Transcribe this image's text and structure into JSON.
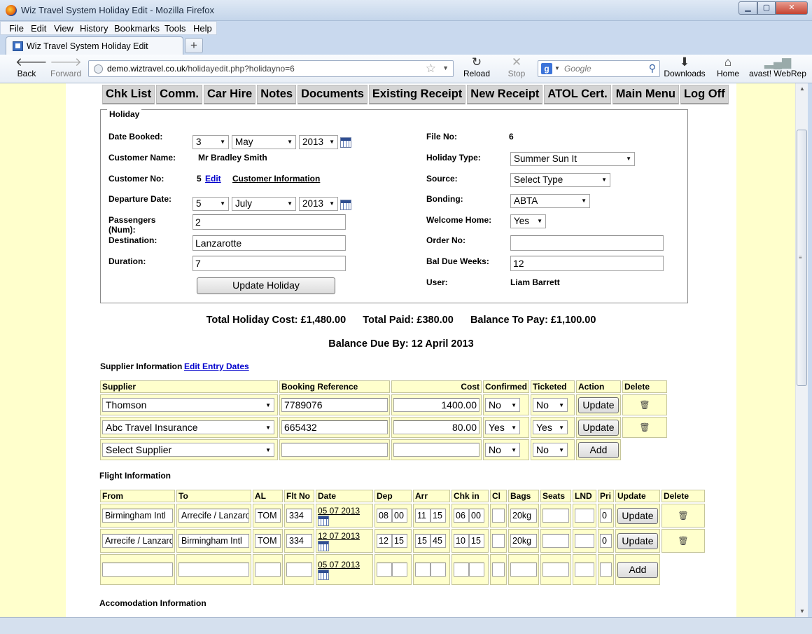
{
  "window": {
    "title": "Wiz Travel System Holiday Edit - Mozilla Firefox"
  },
  "menu": [
    "File",
    "Edit",
    "View",
    "History",
    "Bookmarks",
    "Tools",
    "Help"
  ],
  "tab": {
    "label": "Wiz Travel System Holiday Edit"
  },
  "nav": {
    "back": "Back",
    "forward": "Forward",
    "reload": "Reload",
    "stop": "Stop",
    "downloads": "Downloads",
    "home": "Home",
    "avast": "avast! WebRep",
    "url_host": "demo.wiztravel.co.uk",
    "url_path": "/holidayedit.php?holidayno=6",
    "search_placeholder": "Google"
  },
  "topnav": [
    "Chk List",
    "Comm.",
    "Car Hire",
    "Notes",
    "Documents",
    "Existing Receipt",
    "New Receipt",
    "ATOL Cert.",
    "Main Menu",
    "Log Off"
  ],
  "holiday": {
    "legend": "Holiday",
    "date_booked_label": "Date Booked:",
    "date_booked": {
      "day": "3",
      "month": "May",
      "year": "2013"
    },
    "customer_name_label": "Customer Name:",
    "customer_name": "Mr Bradley Smith",
    "customer_no_label": "Customer No:",
    "customer_no": "5",
    "edit_link": "Edit",
    "customer_info_link": "Customer Information",
    "departure_label": "Departure Date:",
    "departure": {
      "day": "5",
      "month": "July",
      "year": "2013"
    },
    "passengers_label_1": "Passengers",
    "passengers_label_2": "(Num):",
    "passengers": "2",
    "destination_label": "Destination:",
    "destination": "Lanzarotte",
    "duration_label": "Duration:",
    "duration": "7",
    "update_button": "Update Holiday",
    "file_no_label": "File No:",
    "file_no": "6",
    "holiday_type_label": "Holiday Type:",
    "holiday_type": "Summer Sun It",
    "source_label": "Source:",
    "source": "Select Type",
    "bonding_label": "Bonding:",
    "bonding": "ABTA",
    "welcome_home_label": "Welcome Home:",
    "welcome_home": "Yes",
    "order_no_label": "Order No:",
    "order_no": "",
    "bal_due_weeks_label": "Bal Due Weeks:",
    "bal_due_weeks": "12",
    "user_label": "User:",
    "user": "Liam Barrett"
  },
  "totals": {
    "line1": "Total Holiday Cost: £1,480.00      Total Paid: £380.00      Balance To Pay: £1,100.00",
    "line2": "Balance Due By: 12 April 2013"
  },
  "supplier": {
    "title": "Supplier Information",
    "edit_dates_link": "Edit Entry Dates",
    "headers": [
      "Supplier",
      "Booking Reference",
      "Cost",
      "Confirmed",
      "Ticketed",
      "Action",
      "Delete"
    ],
    "rows": [
      {
        "supplier": "Thomson",
        "ref": "7789076",
        "cost": "1400.00",
        "confirmed": "No",
        "ticketed": "No",
        "action": "Update"
      },
      {
        "supplier": "Abc Travel Insurance",
        "ref": "665432",
        "cost": "80.00",
        "confirmed": "Yes",
        "ticketed": "Yes",
        "action": "Update"
      }
    ],
    "new_row": {
      "supplier": "Select Supplier",
      "confirmed": "No",
      "ticketed": "No",
      "action": "Add"
    }
  },
  "flight": {
    "title": "Flight Information",
    "headers": [
      "From",
      "To",
      "AL",
      "Flt No",
      "Date",
      "Dep",
      "Arr",
      "Chk in",
      "Cl",
      "Bags",
      "Seats",
      "LND",
      "Pri",
      "Update",
      "Delete"
    ],
    "rows": [
      {
        "from": "Birmingham Intl",
        "to": "Arrecife / Lanzarote",
        "al": "TOM",
        "flt": "334",
        "date": "05 07 2013",
        "dep_h": "08",
        "dep_m": "00",
        "arr_h": "11",
        "arr_m": "15",
        "chk_h": "06",
        "chk_m": "00",
        "bags": "20kg",
        "pri": "0",
        "action": "Update"
      },
      {
        "from": "Arrecife / Lanzarote",
        "to": "Birmingham Intl",
        "al": "TOM",
        "flt": "334",
        "date": "12 07 2013",
        "dep_h": "12",
        "dep_m": "15",
        "arr_h": "15",
        "arr_m": "45",
        "chk_h": "10",
        "chk_m": "15",
        "bags": "20kg",
        "pri": "0",
        "action": "Update"
      }
    ],
    "new_row": {
      "date": "05 07 2013",
      "action": "Add"
    }
  },
  "accommodation": {
    "title": "Accomodation Information"
  }
}
